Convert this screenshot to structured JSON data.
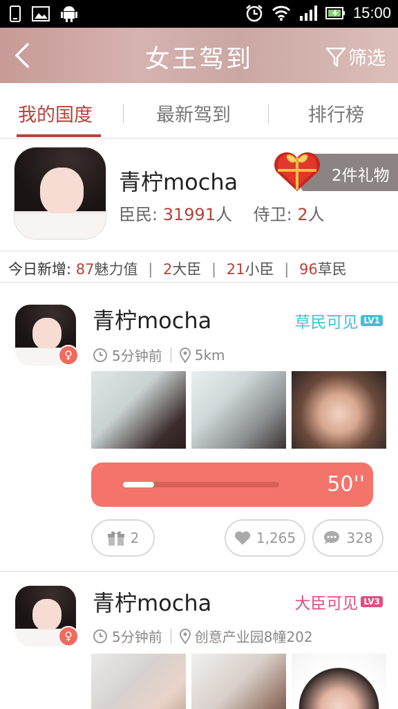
{
  "status_bar": {
    "time": "15:00"
  },
  "header": {
    "title": "女王驾到",
    "filter_label": "筛选"
  },
  "tabs": [
    {
      "label": "我的国度"
    },
    {
      "label": "最新驾到"
    },
    {
      "label": "排行榜"
    }
  ],
  "profile": {
    "name": "青柠mocha",
    "citizens_label": "臣民:",
    "citizens_count": "31991",
    "citizens_unit": "人",
    "guards_label": "侍卫:",
    "guards_count": "2",
    "guards_unit": "人",
    "gifts_label": "2件礼物"
  },
  "today": {
    "label": "今日新增:",
    "charm_value": "87",
    "charm_label": "魅力值",
    "minister_value": "2",
    "minister_label": "大臣",
    "officer_value": "21",
    "officer_label": "小臣",
    "commoner_value": "96",
    "commoner_label": "草民"
  },
  "posts": [
    {
      "name": "青柠mocha",
      "visibility": "草民可见",
      "level": "LV1",
      "time": "5分钟前",
      "location": "5km",
      "voice_duration": "50''",
      "voice_progress": 0.2,
      "gifts": "2",
      "likes": "1,265",
      "comments": "328"
    },
    {
      "name": "青柠mocha",
      "visibility": "大臣可见",
      "level": "LV3",
      "time": "5分钟前",
      "location": "创意产业园8幢202"
    }
  ],
  "colors": {
    "accent": "#b8413a",
    "voice": "#f4736a",
    "cyan": "#3fc0d6",
    "pink": "#e24d80"
  }
}
